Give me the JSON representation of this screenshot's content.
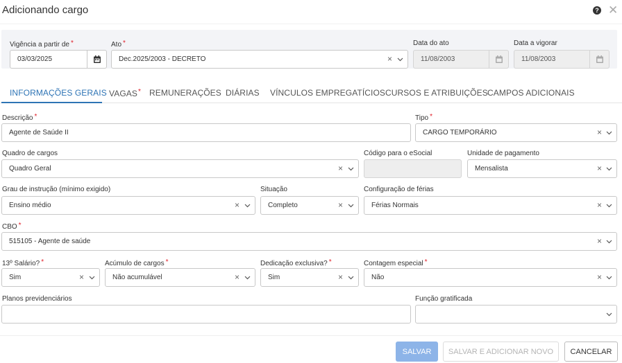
{
  "window": {
    "title": "Adicionando cargo"
  },
  "top": {
    "vigencia": {
      "label": "Vigência a partir de",
      "value": "03/03/2025"
    },
    "ato": {
      "label": "Ato",
      "value": "Dec.2025/2003 - DECRETO"
    },
    "data_ato": {
      "label": "Data do ato",
      "value": "11/08/2003"
    },
    "data_vigorar": {
      "label": "Data a vigorar",
      "value": "11/08/2003"
    }
  },
  "tabs": [
    {
      "label": "INFORMAÇÕES GERAIS"
    },
    {
      "label": "VAGAS"
    },
    {
      "label": "REMUNERAÇÕES"
    },
    {
      "label": "DIÁRIAS"
    },
    {
      "label": "VÍNCULOS EMPREGATÍCIOS"
    },
    {
      "label": "CURSOS E ATRIBUIÇÕES"
    },
    {
      "label": "CAMPOS ADICIONAIS"
    }
  ],
  "form": {
    "descricao": {
      "label": "Descrição",
      "value": "Agente de Saúde II"
    },
    "tipo": {
      "label": "Tipo",
      "value": "CARGO TEMPORÁRIO"
    },
    "quadro": {
      "label": "Quadro de cargos",
      "value": "Quadro Geral"
    },
    "codigo_esocial": {
      "label": "Código para o eSocial",
      "value": ""
    },
    "unidade_pagamento": {
      "label": "Unidade de pagamento",
      "value": "Mensalista"
    },
    "grau_instrucao": {
      "label": "Grau de instrução (mínimo exigido)",
      "value": "Ensino médio"
    },
    "situacao": {
      "label": "Situação",
      "value": "Completo"
    },
    "config_ferias": {
      "label": "Configuração de férias",
      "value": "Férias Normais"
    },
    "cbo": {
      "label": "CBO",
      "value": "515105 - Agente de saúde"
    },
    "decimo_terceiro": {
      "label": "13º Salário?",
      "value": "Sim"
    },
    "acumulo": {
      "label": "Acúmulo de cargos",
      "value": "Não acumulável"
    },
    "dedicacao": {
      "label": "Dedicação exclusiva?",
      "value": "Sim"
    },
    "contagem": {
      "label": "Contagem especial",
      "value": "Não"
    },
    "planos": {
      "label": "Planos previdenciários",
      "value": ""
    },
    "funcao_gratificada": {
      "label": "Função gratificada",
      "value": ""
    }
  },
  "footer": {
    "save_label": "SALVAR",
    "save_new_label": "SALVAR E ADICIONAR NOVO",
    "cancel_label": "CANCELAR"
  },
  "colors": {
    "accent": "#2e74b5",
    "required": "#e0202a",
    "primary_button_disabled": "#8db4e8"
  },
  "icons": [
    "help-icon",
    "close-icon",
    "calendar-icon",
    "clear-icon",
    "chevron-down-icon"
  ]
}
